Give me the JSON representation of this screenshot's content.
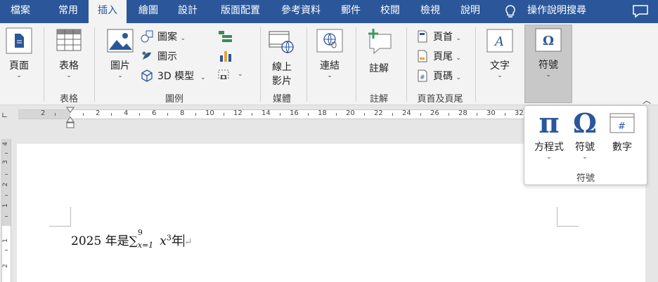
{
  "menu": {
    "tabs": [
      "檔案",
      "常用",
      "插入",
      "繪圖",
      "設計",
      "版面配置",
      "參考資料",
      "郵件",
      "校閱",
      "檢視",
      "說明"
    ],
    "active_index": 2,
    "help_search": "操作說明搜尋"
  },
  "ribbon": {
    "page": "頁面",
    "table": "表格",
    "table_group": "表格",
    "picture": "圖片",
    "shapes": "圖案",
    "icons": "圖示",
    "models_3d": "3D 模型",
    "illustrations_group": "圖例",
    "online_video_1": "線上",
    "online_video_2": "影片",
    "media_group": "媒體",
    "link": "連結",
    "comment": "註解",
    "comments_group": "註解",
    "header": "頁首",
    "footer": "頁尾",
    "page_number": "頁碼",
    "header_footer_group": "頁首及頁尾",
    "text": "文字",
    "symbols": "符號"
  },
  "symbols_popup": {
    "equation": "方程式",
    "symbol": "符號",
    "number": "數字",
    "group_label": "符號"
  },
  "ruler": {
    "h_labels": [
      "2",
      "2",
      "4",
      "6",
      "8",
      "10",
      "12",
      "14",
      "16",
      "18",
      "20",
      "22",
      "24",
      "26",
      "28",
      "30",
      "32"
    ],
    "v_labels": [
      "4",
      "3",
      "2",
      "1",
      "1",
      "2"
    ]
  },
  "document": {
    "before": "2025 年是",
    "sigma": "∑",
    "sub": "x=1",
    "sup": "9",
    "var": "x",
    "exp": "3",
    "after": "年"
  },
  "colors": {
    "accent": "#2b579a",
    "ribbon": "#f3f3f3"
  }
}
